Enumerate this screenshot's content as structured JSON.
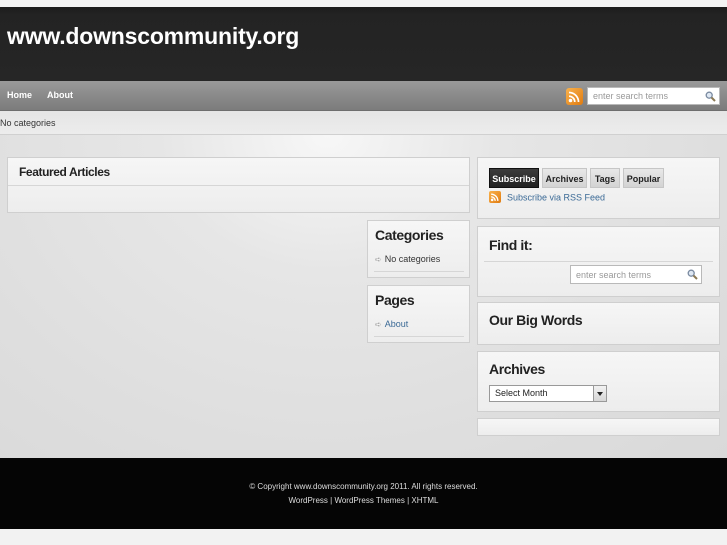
{
  "header": {
    "site_title": "www.downscommunity.org"
  },
  "nav": {
    "items": [
      {
        "label": "Home"
      },
      {
        "label": "About"
      }
    ],
    "rss_icon": "rss-feed-icon",
    "search": {
      "placeholder": "enter search terms",
      "icon": "magnifier-icon"
    }
  },
  "subbar": {
    "text": "No categories"
  },
  "main": {
    "featured": {
      "title": "Featured Articles"
    },
    "categories": {
      "title": "Categories",
      "items": [
        {
          "label": "No categories"
        }
      ]
    },
    "pages": {
      "title": "Pages",
      "items": [
        {
          "label": "About"
        }
      ]
    }
  },
  "sidebar": {
    "tabs": [
      {
        "label": "Subscribe",
        "active": true
      },
      {
        "label": "Archives",
        "active": false
      },
      {
        "label": "Tags",
        "active": false
      },
      {
        "label": "Popular",
        "active": false
      }
    ],
    "rss_link": "Subscribe via RSS Feed",
    "findit": {
      "title": "Find it:",
      "placeholder": "enter search terms"
    },
    "bigwords": {
      "title": "Our Big Words"
    },
    "archives": {
      "title": "Archives",
      "select_value": "Select Month"
    }
  },
  "footer": {
    "copyright": "© Copyright www.downscommunity.org 2011. All rights reserved.",
    "links": [
      "WordPress",
      "WordPress Themes",
      "XHTML"
    ],
    "separator": "|"
  },
  "colors": {
    "header_bg": "#262626",
    "nav_bg": "#8a8a8a",
    "link": "#3b6a96",
    "rss_orange": "#f09a2b",
    "active_tab": "#2a2a2a",
    "footer_bg": "#050505"
  }
}
